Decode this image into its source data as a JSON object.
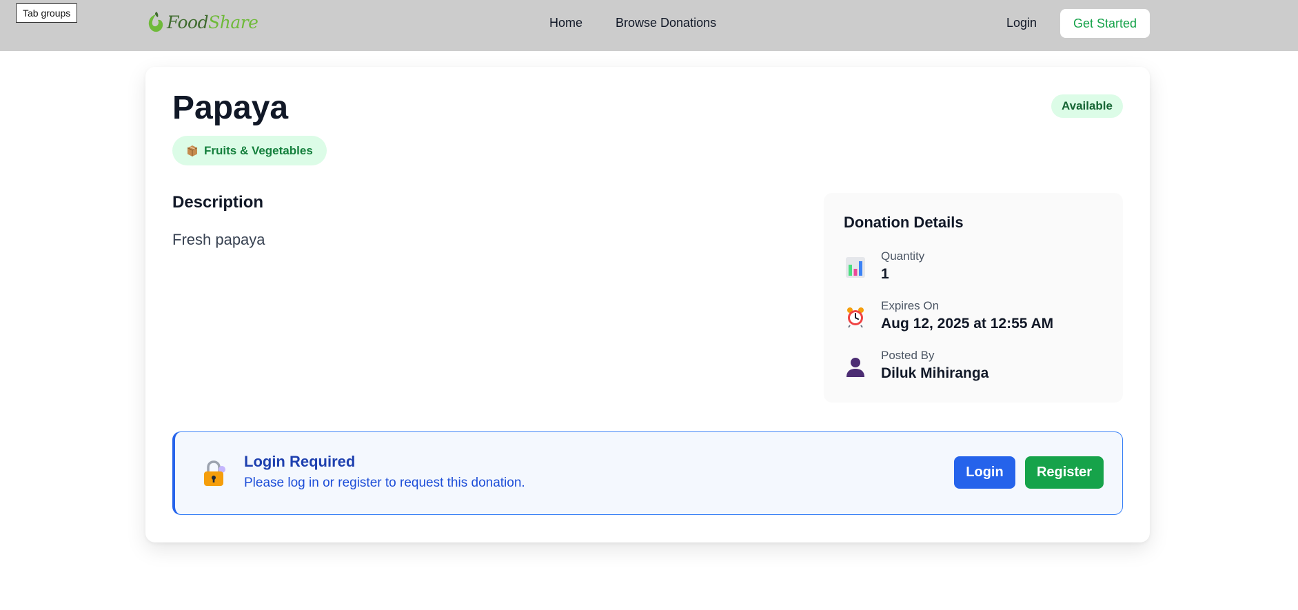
{
  "browser": {
    "tab_groups_label": "Tab groups"
  },
  "nav": {
    "logo_part1": "Food",
    "logo_part2": "Share",
    "links": [
      {
        "label": "Home"
      },
      {
        "label": "Browse Donations"
      }
    ],
    "login_label": "Login",
    "get_started_label": "Get Started"
  },
  "donation": {
    "title": "Papaya",
    "status": "Available",
    "category": "Fruits & Vegetables",
    "category_icon": "package-icon",
    "description_heading": "Description",
    "description": "Fresh papaya"
  },
  "details": {
    "heading": "Donation Details",
    "rows": [
      {
        "icon": "bar-chart-icon",
        "label": "Quantity",
        "value": "1"
      },
      {
        "icon": "alarm-clock-icon",
        "label": "Expires On",
        "value": "Aug 12, 2025 at 12:55 AM"
      },
      {
        "icon": "person-icon",
        "label": "Posted By",
        "value": "Diluk Mihiranga"
      }
    ]
  },
  "login_required": {
    "icon": "lock-icon",
    "title": "Login Required",
    "message": "Please log in or register to request this donation.",
    "login_button": "Login",
    "register_button": "Register"
  },
  "colors": {
    "nav_bg": "#cccccc",
    "brand_green": "#16a34a",
    "status_bg": "#dcfce7",
    "info_blue": "#2563eb",
    "info_bg": "#f4f8fe"
  }
}
